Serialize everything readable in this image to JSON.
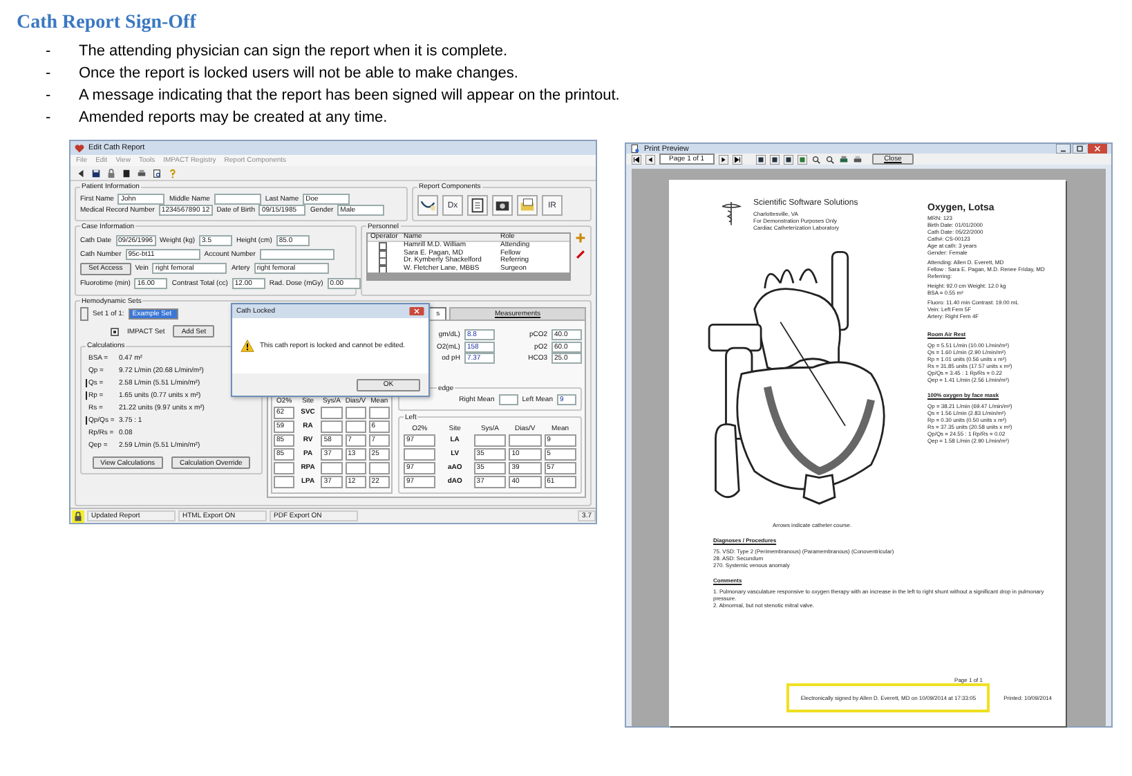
{
  "title": "Cath Report Sign-Off",
  "bullets": [
    {
      "marker": "-",
      "text": "The attending physician can sign the report when it is complete."
    },
    {
      "marker": "-",
      "text": "Once the report is locked users will not be able to make changes."
    },
    {
      "marker": "-",
      "text": "A message indicating that the report has been signed will appear on the printout."
    },
    {
      "marker": "-",
      "text": "Amended reports may be created at any time."
    }
  ],
  "edit_window": {
    "title": "Edit Cath Report",
    "menu": [
      "File",
      "Edit",
      "View",
      "Tools",
      "IMPACT Registry",
      "Report Components"
    ],
    "patient": {
      "title": "Patient Information",
      "field_lines": [
        [
          {
            "label": "First Name",
            "value": "John"
          },
          {
            "label": "Middle Name"
          },
          {
            "label": "Last Name",
            "value": "Doe"
          }
        ],
        [
          {
            "label": "Medical Record Number",
            "value": "1234567890 12"
          },
          {
            "label": "Date of Birth",
            "value": "09/15/1985"
          },
          {
            "label": "Gender",
            "value": "Male"
          }
        ]
      ]
    },
    "components": {
      "title": "Report Components",
      "buttons": [
        {
          "kind": "stethoscope"
        },
        {
          "kind": "text",
          "label": "Dx"
        },
        {
          "kind": "document"
        },
        {
          "kind": "camera"
        },
        {
          "kind": "folder"
        },
        {
          "kind": "text",
          "label": "IR"
        }
      ]
    },
    "case": {
      "title": "Case Information",
      "field_lines": [
        [
          {
            "label": "Cath Date",
            "value": "09/26/1996"
          },
          {
            "label": "Weight (kg)",
            "value": "3.5"
          },
          {
            "label": "Height (cm)",
            "value": "85.0"
          }
        ],
        [
          {
            "label": "Cath Number",
            "value": "95c-bt11"
          },
          {
            "label": "Account Number"
          }
        ],
        [
          {
            "label": "Vein",
            "value": "right femoral"
          },
          {
            "label": "Artery",
            "value": "right femoral"
          }
        ],
        [
          {
            "label": "Fluorotime (min)",
            "value": "16.00"
          },
          {
            "label": "Contrast Total (cc)",
            "value": "12.00"
          },
          {
            "label": "Rad. Dose (mGy)",
            "value": "0.00"
          }
        ]
      ],
      "set_access": "Set Access"
    },
    "personnel": {
      "title": "Personnel",
      "columns": [
        "Operator",
        "Name",
        "Role"
      ],
      "rows": [
        {
          "checked": false,
          "name": "Hamrill M.D. William",
          "role": "Attending"
        },
        {
          "checked": false,
          "name": "Sara E. Pagan, MD",
          "role": "Fellow"
        },
        {
          "checked": false,
          "name": "Dr. Kymberly Shackelford",
          "role": "Referring"
        },
        {
          "checked": false,
          "name": "W. Fletcher Lane, MBBS",
          "role": "Surgeon"
        }
      ]
    },
    "hemo": {
      "title": "Hemodynamic Sets",
      "set_label": "Set 1 of 1:",
      "set_value": "Example Set",
      "impact_set": {
        "label": "IMPACT Set",
        "checked": true
      },
      "add_set": "Add Set",
      "calc_title": "Calculations",
      "calculations": [
        {
          "label": "BSA =",
          "value": "0.47 m²",
          "flagged": false
        },
        {
          "label": "Qp =",
          "value": "9.72 L/min (20.68 L/min/m²)",
          "flagged": false
        },
        {
          "label": "Qs =",
          "value": "2.58 L/min (5.51 L/min/m²)",
          "flagged": true
        },
        {
          "label": "Rp =",
          "value": "1.65 units (0.77 units x m²)",
          "flagged": true
        },
        {
          "label": "Rs =",
          "value": "21.22 units (9.97 units x m²)",
          "flagged": false
        },
        {
          "label": "Qp/Qs =",
          "value": "3.75 : 1",
          "flagged": true
        },
        {
          "label": "Rp/Rs =",
          "value": "0.08",
          "flagged": false
        },
        {
          "label": "Qep =",
          "value": "2.59 L/min (5.51 L/min/m²)",
          "flagged": false
        }
      ],
      "view_calc": "View Calculations",
      "calc_override": "Calculation Override",
      "tabs": [
        {
          "label": "s",
          "selected": true
        },
        {
          "label": "Measurements",
          "selected": false
        }
      ],
      "oximetry_left": [
        {
          "label": "gm/dL)",
          "value": "8.8"
        },
        {
          "label": "O2(mL)",
          "value": "158"
        },
        {
          "label": "od pH",
          "value": "7.37"
        }
      ],
      "oximetry_right": [
        {
          "label": "pCO2",
          "value": "40.0"
        },
        {
          "label": "pO2",
          "value": "60.0"
        },
        {
          "label": "HCO3",
          "value": "25.0"
        }
      ],
      "wedge": {
        "title": "edge",
        "fields": [
          {
            "label": "Right Mean"
          },
          {
            "label": "Left Mean",
            "value": "9"
          }
        ]
      },
      "right_table": {
        "columns": [
          "O2%",
          "Site",
          "Sys/A",
          "Dias/V",
          "Mean"
        ],
        "rows": [
          [
            "62",
            "SVC",
            "",
            "",
            ""
          ],
          [
            "59",
            "RA",
            "",
            "",
            "6"
          ],
          [
            "85",
            "RV",
            "58",
            "7",
            "7"
          ],
          [
            "85",
            "PA",
            "37",
            "13",
            "25"
          ],
          [
            "",
            "RPA",
            "",
            "",
            ""
          ],
          [
            "",
            "LPA",
            "37",
            "12",
            "22"
          ]
        ]
      },
      "left_table": {
        "title": "Left",
        "columns": [
          "O2%",
          "Site",
          "Sys/A",
          "Dias/V",
          "Mean"
        ],
        "rows": [
          [
            "97",
            "LA",
            "",
            "",
            "9"
          ],
          [
            "",
            "LV",
            "35",
            "10",
            "5"
          ],
          [
            "97",
            "aAO",
            "35",
            "39",
            "57"
          ],
          [
            "97",
            "dAO",
            "37",
            "40",
            "61"
          ]
        ]
      }
    },
    "dialog": {
      "title": "Cath Locked",
      "message": "This cath report is locked and cannot be edited.",
      "button": "OK"
    },
    "status_bar": [
      "Updated Report",
      "HTML Export ON",
      "PDF Export ON",
      "3.7"
    ]
  },
  "preview_window": {
    "title": "Print Preview",
    "page_field": "Page 1 of 1",
    "close": "Close",
    "org": {
      "name": "Scientific Software Solutions",
      "lines": [
        "Charlottesville, VA",
        "For Demonstration Purposes Only",
        "Cardiac Catheterization Laboratory"
      ]
    },
    "patient_name": "Oxygen, Lotsa",
    "info_groups": [
      [
        "MRN: 123",
        "Birth Date: 01/01/2000",
        "Cath Date: 05/22/2000",
        "Cath#: CS-00123",
        "Age at cath: 3 years",
        "Gender: Female"
      ],
      [
        "Attending: Allen D. Everett, MD",
        "Fellow : Sara E. Pagan, M.D. Renee Friday, MD",
        "Referring:"
      ],
      [
        "Height: 92.0 cm  Weight: 12.0 kg",
        "BSA = 0.55 m²"
      ],
      [
        "Fluoro: 11.40 min  Contrast: 19.00 mL",
        "Vein: Left Fem 5F",
        "Artery: Right Fem 4F"
      ]
    ],
    "conditions": [
      {
        "heading": "Room Air Rest",
        "lines": [
          "Qp = 5.51 L/min (10.00 L/min/m²)",
          "Qs = 1.60 L/min (2.90 L/min/m²)",
          "Rp = 1.01 units (0.56 units x m²)",
          "Rs = 31.85 units (17.57 units x m²)",
          "Qp/Qs = 3.45 : 1  Rp/Rs = 0.22",
          "Qep = 1.41 L/min (2.56 L/min/m²)"
        ]
      },
      {
        "heading": "100% oxygen by face mask",
        "lines": [
          "Qp = 38.21 L/min (69.47 L/min/m²)",
          "Qs = 1.56 L/min (2.83 L/min/m²)",
          "Rp = 0.30 units (0.50 units x m²)",
          "Rs = 37.35 units (20.58 units x m²)",
          "Qp/Qs = 24.55 : 1  Rp/Rs = 0.02",
          "Qep = 1.58 L/min (2.90 L/min/m²)"
        ]
      }
    ],
    "caption": "Arrows indicate catheter course.",
    "sections": [
      {
        "heading": "Diagnoses / Procedures",
        "lines": [
          "75. VSD: Type 2 (Perimembranous) (Paramembranous) (Conoventricular)",
          "28. ASD: Secundum",
          "270. Systemic venous anomaly"
        ]
      },
      {
        "heading": "Comments",
        "lines": [
          "1. Pulmonary vasculature responsive to oxygen therapy with an increase in the left to right shunt without a significant drop in pulmonary pressure.",
          "2. Abnormal, but not stenotic mitral valve."
        ]
      }
    ],
    "page_number": "Page 1 of 1",
    "signature": "Electronically signed by Allen D. Everett, MD on 10/09/2014 at 17:33:05",
    "printed": "Printed: 10/09/2014"
  }
}
